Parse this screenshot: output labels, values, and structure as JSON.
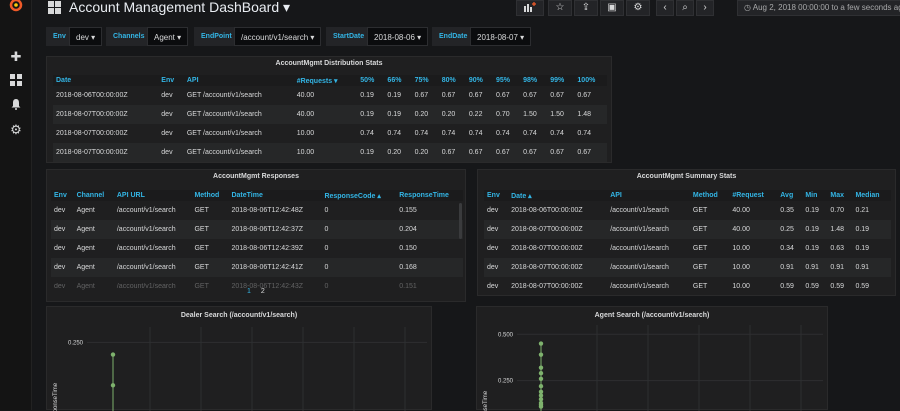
{
  "dashboard": {
    "title": "Account Management DashBoard",
    "time_range": "Aug 2, 2018 00:00:00 to a few seconds ago"
  },
  "colors": {
    "accent": "#33b5e5",
    "series": "#7eb26d",
    "background": "#161719"
  },
  "filters": [
    {
      "label": "Env",
      "value": "dev"
    },
    {
      "label": "Channels",
      "value": "Agent"
    },
    {
      "label": "EndPoint",
      "value": "/account/v1/search"
    },
    {
      "label": "StartDate",
      "value": "2018-08-06"
    },
    {
      "label": "EndDate",
      "value": "2018-08-07"
    }
  ],
  "distribution": {
    "title": "AccountMgmt Distribution Stats",
    "headers": [
      "Date",
      "Env",
      "API",
      "#Requests",
      "50%",
      "66%",
      "75%",
      "80%",
      "90%",
      "95%",
      "98%",
      "99%",
      "100%"
    ],
    "rows": [
      [
        "2018-08-06T00:00:00Z",
        "dev",
        "GET /account/v1/search",
        "40.00",
        "0.19",
        "0.19",
        "0.67",
        "0.67",
        "0.67",
        "0.67",
        "0.67",
        "0.67",
        "0.67"
      ],
      [
        "2018-08-07T00:00:00Z",
        "dev",
        "GET /account/v1/search",
        "40.00",
        "0.19",
        "0.19",
        "0.20",
        "0.20",
        "0.22",
        "0.70",
        "1.50",
        "1.50",
        "1.48"
      ],
      [
        "2018-08-07T00:00:00Z",
        "dev",
        "GET /account/v1/search",
        "10.00",
        "0.74",
        "0.74",
        "0.74",
        "0.74",
        "0.74",
        "0.74",
        "0.74",
        "0.74",
        "0.74"
      ],
      [
        "2018-08-07T00:00:00Z",
        "dev",
        "GET /account/v1/search",
        "10.00",
        "0.19",
        "0.20",
        "0.20",
        "0.67",
        "0.67",
        "0.67",
        "0.67",
        "0.67",
        "0.67"
      ]
    ]
  },
  "responses": {
    "title": "AccountMgmt Responses",
    "headers": [
      "Env",
      "Channel",
      "API URL",
      "Method",
      "DateTime",
      "ResponseCode",
      "ResponseTime"
    ],
    "rows": [
      [
        "dev",
        "Agent",
        "/account/v1/search",
        "GET",
        "2018-08-06T12:42:48Z",
        "0",
        "0.155"
      ],
      [
        "dev",
        "Agent",
        "/account/v1/search",
        "GET",
        "2018-08-06T12:42:37Z",
        "0",
        "0.204"
      ],
      [
        "dev",
        "Agent",
        "/account/v1/search",
        "GET",
        "2018-08-06T12:42:39Z",
        "0",
        "0.150"
      ],
      [
        "dev",
        "Agent",
        "/account/v1/search",
        "GET",
        "2018-08-06T12:42:41Z",
        "0",
        "0.168"
      ],
      [
        "dev",
        "Agent",
        "/account/v1/search",
        "GET",
        "2018-08-06T12:42:43Z",
        "0",
        "0.151"
      ]
    ],
    "pages": [
      "1",
      "2"
    ]
  },
  "summary": {
    "title": "AccountMgmt Summary Stats",
    "headers": [
      "Env",
      "Date",
      "API",
      "Method",
      "#Request",
      "Avg",
      "Min",
      "Max",
      "Median"
    ],
    "rows": [
      [
        "dev",
        "2018-08-06T00:00:00Z",
        "/account/v1/search",
        "GET",
        "40.00",
        "0.35",
        "0.19",
        "0.70",
        "0.21"
      ],
      [
        "dev",
        "2018-08-07T00:00:00Z",
        "/account/v1/search",
        "GET",
        "40.00",
        "0.25",
        "0.19",
        "1.48",
        "0.19"
      ],
      [
        "dev",
        "2018-08-07T00:00:00Z",
        "/account/v1/search",
        "GET",
        "10.00",
        "0.34",
        "0.19",
        "0.63",
        "0.19"
      ],
      [
        "dev",
        "2018-08-07T00:00:00Z",
        "/account/v1/search",
        "GET",
        "10.00",
        "0.91",
        "0.91",
        "0.91",
        "0.91"
      ],
      [
        "dev",
        "2018-08-07T00:00:00Z",
        "/account/v1/search",
        "GET",
        "10.00",
        "0.59",
        "0.59",
        "0.59",
        "0.59"
      ]
    ]
  },
  "chart_data": [
    {
      "type": "scatter",
      "title": "Dealer Search (/account/v1/search)",
      "ylabel": "ResponseTime",
      "ylim": [
        0,
        0.3
      ],
      "yticks": [
        "0.250"
      ],
      "y_tick_values": [
        0.25
      ],
      "grid": true,
      "series": [
        {
          "values": [
            0.21,
            0.11
          ]
        }
      ]
    },
    {
      "type": "scatter",
      "title": "Agent Search (/account/v1/search)",
      "ylabel": "ResponseTime",
      "ylim": [
        0,
        0.55
      ],
      "yticks": [
        "0.500",
        "0.250"
      ],
      "y_tick_values": [
        0.5,
        0.25
      ],
      "grid": true,
      "series": [
        {
          "values": [
            0.45,
            0.39,
            0.32,
            0.29,
            0.26,
            0.22,
            0.19,
            0.17,
            0.15,
            0.13,
            0.12,
            0.11
          ]
        }
      ]
    }
  ]
}
